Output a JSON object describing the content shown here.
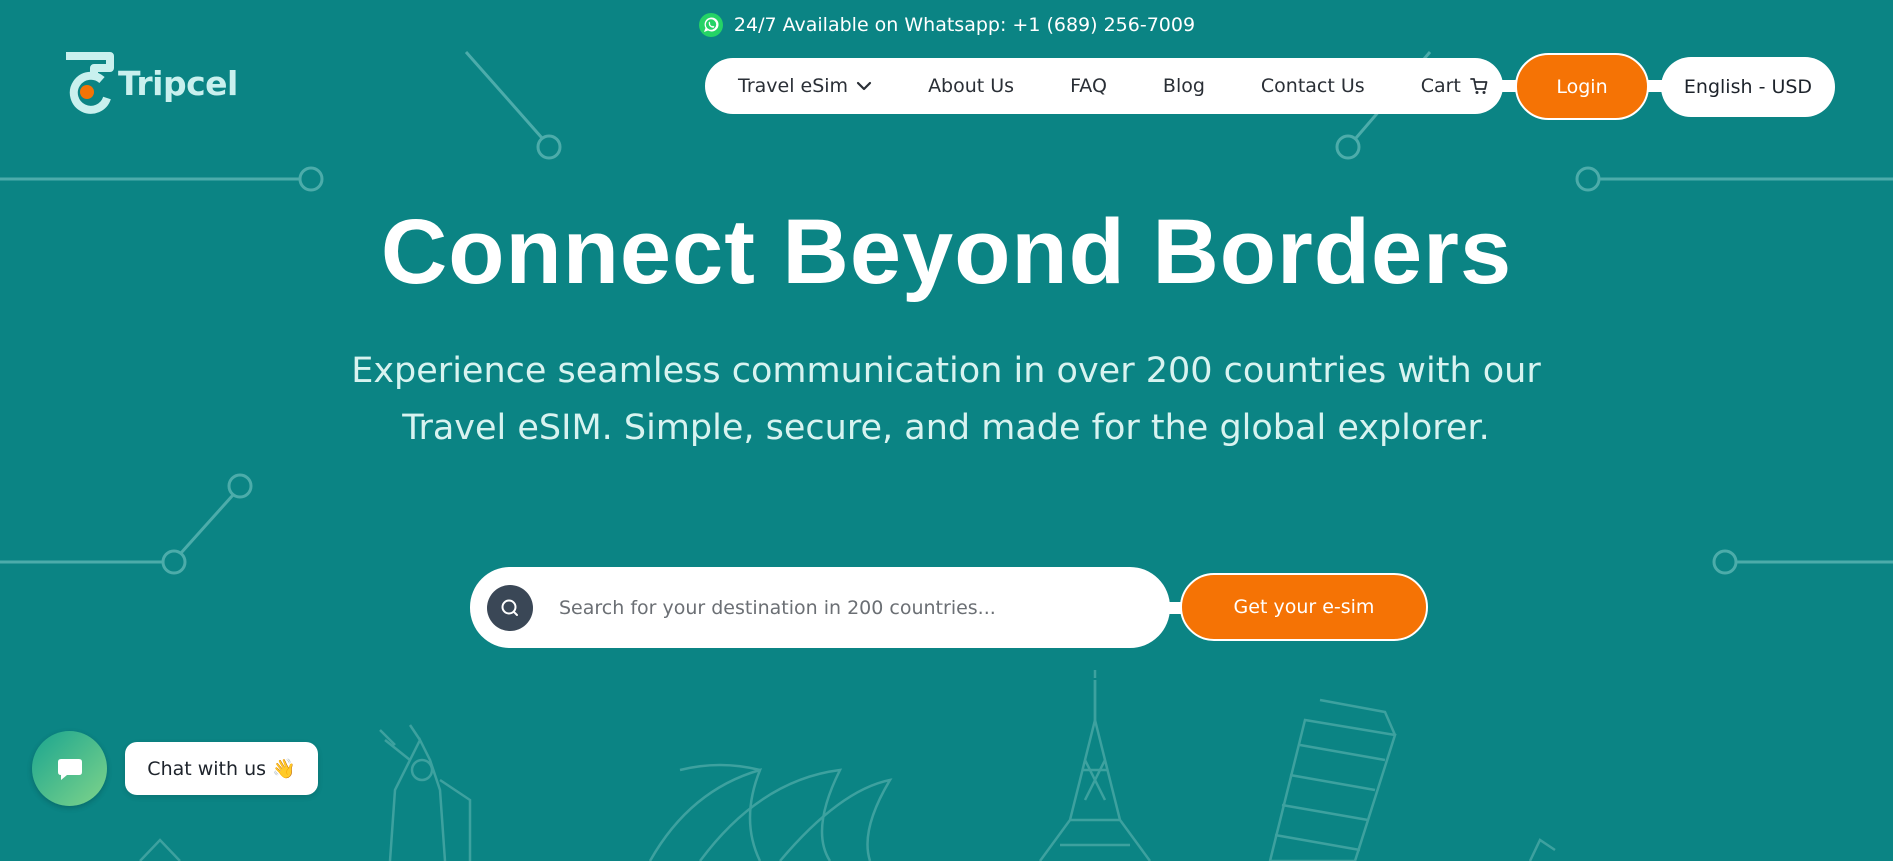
{
  "topbar": {
    "whatsapp_text": "24/7 Available on Whatsapp: +1 (689) 256-7009",
    "icon": "whatsapp-icon"
  },
  "brand": {
    "name": "Tripcel"
  },
  "nav": {
    "items": [
      {
        "label": "Travel eSim",
        "icon": "chevron-down-icon"
      },
      {
        "label": "About Us"
      },
      {
        "label": "FAQ"
      },
      {
        "label": "Blog"
      },
      {
        "label": "Contact Us"
      },
      {
        "label": "Cart",
        "icon": "cart-icon"
      }
    ],
    "login_label": "Login",
    "language_label": "English - USD"
  },
  "hero": {
    "title": "Connect Beyond Borders",
    "subtitle_line1": "Experience seamless communication in over 200 countries with our",
    "subtitle_line2": "Travel eSIM. Simple, secure, and made for the global explorer."
  },
  "search": {
    "placeholder": "Search for your destination in 200 countries...",
    "value": "",
    "button_label": "Get your e-sim"
  },
  "chat": {
    "label": "Chat with us",
    "emoji": "👋"
  },
  "colors": {
    "background": "#0b8484",
    "accent": "#f57305",
    "line_art": "#5bb8b5"
  }
}
